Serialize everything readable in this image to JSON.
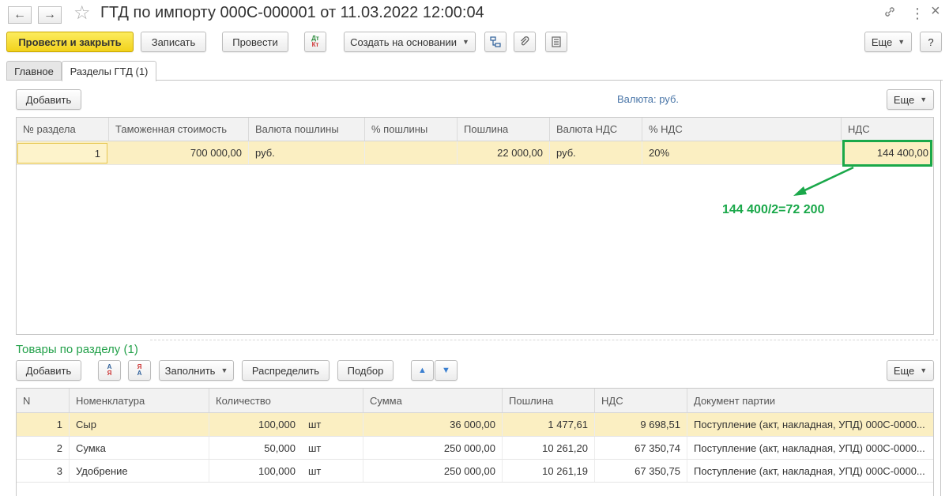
{
  "window": {
    "title": "ГТД по импорту 000С-000001 от 11.03.2022 12:00:04",
    "back_icon": "←",
    "forward_icon": "→",
    "star_icon": "☆",
    "link_icon": "🔗",
    "menu_icon": "⋮",
    "close_icon": "×"
  },
  "toolbar": {
    "post_close": "Провести и закрыть",
    "save": "Записать",
    "post": "Провести",
    "dtkt_top": "Дт",
    "dtkt_bottom": "Кт",
    "create_based": "Создать на основании",
    "more": "Еще",
    "help": "?"
  },
  "tabs": [
    {
      "label": "Главное",
      "active": false
    },
    {
      "label": "Разделы ГТД (1)",
      "active": true
    }
  ],
  "sections": {
    "add_label": "Добавить",
    "currency_text": "Валюта: руб.",
    "more_label": "Еще",
    "columns": [
      "№ раздела",
      "Таможенная стоимость",
      "Валюта пошлины",
      "% пошлины",
      "Пошлина",
      "Валюта НДС",
      "% НДС",
      "НДС"
    ],
    "rows": [
      {
        "num": "1",
        "customs_value": "700 000,00",
        "duty_currency": "руб.",
        "duty_pct": "",
        "duty": "22 000,00",
        "vat_currency": "руб.",
        "vat_pct": "20%",
        "vat": "144 400,00"
      }
    ]
  },
  "annotation": {
    "text": "144 400/2=72 200",
    "color": "#1aa84a"
  },
  "goods": {
    "title": "Товары по разделу (1)",
    "add_label": "Добавить",
    "sort_asc_top": "А",
    "sort_asc_bottom": "Я",
    "sort_desc_top": "Я",
    "sort_desc_bottom": "А",
    "fill_label": "Заполнить",
    "distribute_label": "Распределить",
    "select_label": "Подбор",
    "up_icon": "▲",
    "down_icon": "▼",
    "more_label": "Еще",
    "columns": [
      "N",
      "Номенклатура",
      "Количество",
      "Сумма",
      "Пошлина",
      "НДС",
      "Документ партии"
    ],
    "rows": [
      {
        "n": "1",
        "name": "Сыр",
        "qty": "100,000",
        "unit": "шт",
        "sum": "36 000,00",
        "duty": "1 477,61",
        "vat": "9 698,51",
        "doc": "Поступление (акт, накладная, УПД) 000С-0000..."
      },
      {
        "n": "2",
        "name": "Сумка",
        "qty": "50,000",
        "unit": "шт",
        "sum": "250 000,00",
        "duty": "10 261,20",
        "vat": "67 350,74",
        "doc": "Поступление (акт, накладная, УПД) 000С-0000..."
      },
      {
        "n": "3",
        "name": "Удобрение",
        "qty": "100,000",
        "unit": "шт",
        "sum": "250 000,00",
        "duty": "10 261,19",
        "vat": "67 350,75",
        "doc": "Поступление (акт, накладная, УПД) 000С-0000..."
      }
    ]
  },
  "colors": {
    "primary_button": "#f5d92a",
    "selected_row": "#fbefc2",
    "section_title": "#23a14a",
    "currency_link": "#4a76a8"
  }
}
